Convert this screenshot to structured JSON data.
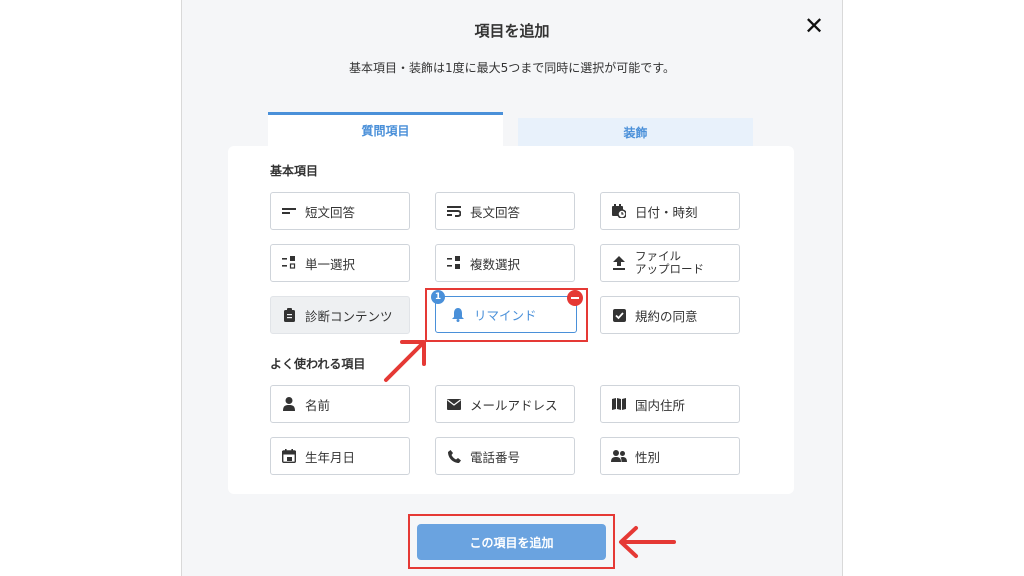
{
  "modal": {
    "title": "項目を追加",
    "close_label": "✕",
    "subtitle": "基本項目・装飾は1度に最大5つまで同時に選択が可能です。"
  },
  "tabs": [
    {
      "label": "質問項目",
      "active": true
    },
    {
      "label": "装飾",
      "active": false
    }
  ],
  "sections": {
    "basic": {
      "label": "基本項目",
      "items": [
        {
          "label": "短文回答",
          "icon": "short-text-icon"
        },
        {
          "label": "長文回答",
          "icon": "long-text-icon"
        },
        {
          "label": "日付・時刻",
          "icon": "calendar-clock-icon"
        },
        {
          "label": "単一選択",
          "icon": "single-choice-icon"
        },
        {
          "label": "複数選択",
          "icon": "multi-choice-icon"
        },
        {
          "label": "ファイル",
          "label2": "アップロード",
          "icon": "upload-icon"
        },
        {
          "label": "診断コンテンツ",
          "icon": "clipboard-icon",
          "disabled": true
        },
        {
          "label": "リマインド",
          "icon": "bell-icon",
          "selected": true,
          "order": "1"
        },
        {
          "label": "規約の同意",
          "icon": "checkbox-icon"
        }
      ]
    },
    "common": {
      "label": "よく使われる項目",
      "items": [
        {
          "label": "名前",
          "icon": "person-icon"
        },
        {
          "label": "メールアドレス",
          "icon": "envelope-icon"
        },
        {
          "label": "国内住所",
          "icon": "map-icon"
        },
        {
          "label": "生年月日",
          "icon": "birthday-calendar-icon"
        },
        {
          "label": "電話番号",
          "icon": "phone-icon"
        },
        {
          "label": "性別",
          "icon": "people-icon"
        }
      ]
    }
  },
  "footer": {
    "add_button": "この項目を追加"
  },
  "colors": {
    "accent": "#4a90d9",
    "highlight": "#e53935",
    "button": "#6aa3e0"
  }
}
